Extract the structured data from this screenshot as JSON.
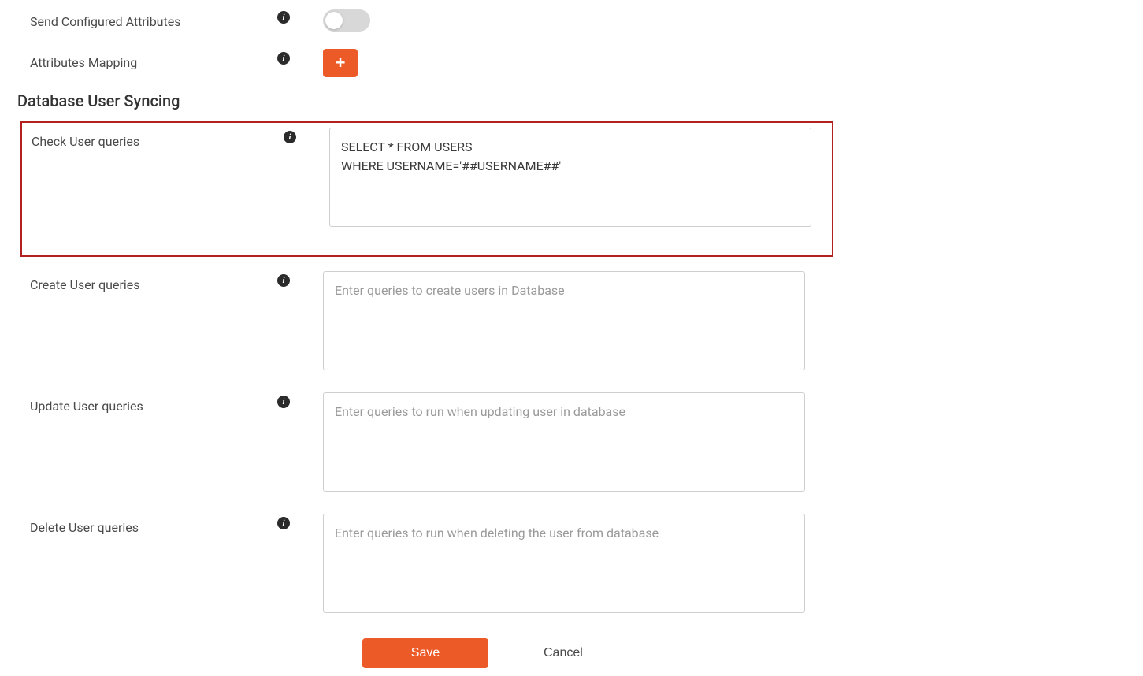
{
  "settings": {
    "sendConfiguredAttributes": {
      "label": "Send Configured Attributes"
    },
    "attributesMapping": {
      "label": "Attributes Mapping"
    }
  },
  "syncing": {
    "title": "Database User Syncing",
    "checkUser": {
      "label": "Check User queries",
      "value": "SELECT * FROM USERS\nWHERE USERNAME='##USERNAME##'"
    },
    "createUser": {
      "label": "Create User queries",
      "placeholder": "Enter queries to create users in Database",
      "value": ""
    },
    "updateUser": {
      "label": "Update User queries",
      "placeholder": "Enter queries to run when updating user in database",
      "value": ""
    },
    "deleteUser": {
      "label": "Delete User queries",
      "placeholder": "Enter queries to run when deleting the user from database",
      "value": ""
    }
  },
  "actions": {
    "save": "Save",
    "cancel": "Cancel"
  },
  "icons": {
    "info": "i",
    "plus": "+"
  }
}
